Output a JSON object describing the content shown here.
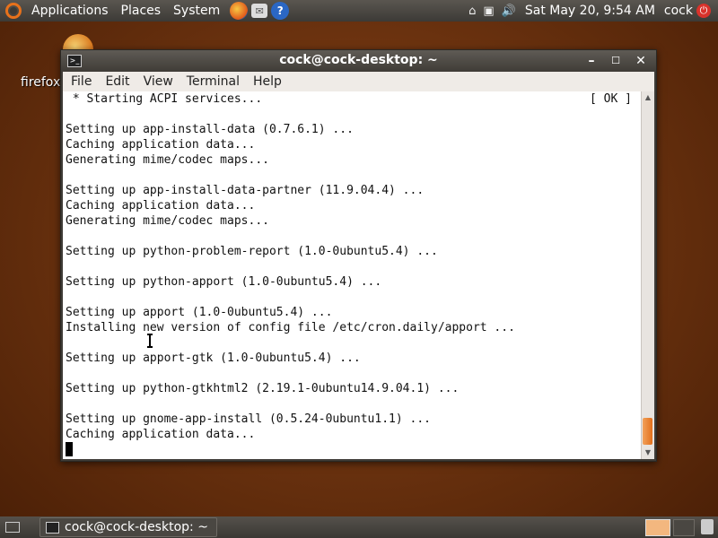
{
  "top_panel": {
    "menus": [
      "Applications",
      "Places",
      "System"
    ],
    "launchers": [
      {
        "icon": "firefox-icon"
      },
      {
        "icon": "mail-icon",
        "glyph": "✉"
      },
      {
        "icon": "help-icon",
        "glyph": "?"
      }
    ],
    "tray_glyphs": {
      "network": "⌂",
      "display": "▣",
      "volume": "🔊"
    },
    "clock": "Sat May 20,  9:54 AM",
    "user": "cock",
    "accent_color": "#e7711b"
  },
  "desktop": {
    "icon_label": "firefox"
  },
  "window": {
    "title": "cock@cock-desktop: ~",
    "menu": [
      "File",
      "Edit",
      "View",
      "Terminal",
      "Help"
    ],
    "buttons": {
      "minimize": "–",
      "maximize": "☐",
      "close": "✕"
    },
    "terminal": {
      "lines": [
        " * Starting ACPI services...",
        "",
        "Setting up app-install-data (0.7.6.1) ...",
        "Caching application data...",
        "Generating mime/codec maps...",
        "",
        "Setting up app-install-data-partner (11.9.04.4) ...",
        "Caching application data...",
        "Generating mime/codec maps...",
        "",
        "Setting up python-problem-report (1.0-0ubuntu5.4) ...",
        "",
        "Setting up python-apport (1.0-0ubuntu5.4) ...",
        "",
        "Setting up apport (1.0-0ubuntu5.4) ...",
        "Installing new version of config file /etc/cron.daily/apport ...",
        "",
        "Setting up apport-gtk (1.0-0ubuntu5.4) ...",
        "",
        "Setting up python-gtkhtml2 (2.19.1-0ubuntu14.9.04.1) ...",
        "",
        "Setting up gnome-app-install (0.5.24-0ubuntu1.1) ...",
        "Caching application data..."
      ],
      "status_tag": "[ OK ]"
    },
    "scrollbar_thumb_color": "#e2701c",
    "scroll_position": 0.98
  },
  "bottom_panel": {
    "task_label": "cock@cock-desktop: ~"
  }
}
